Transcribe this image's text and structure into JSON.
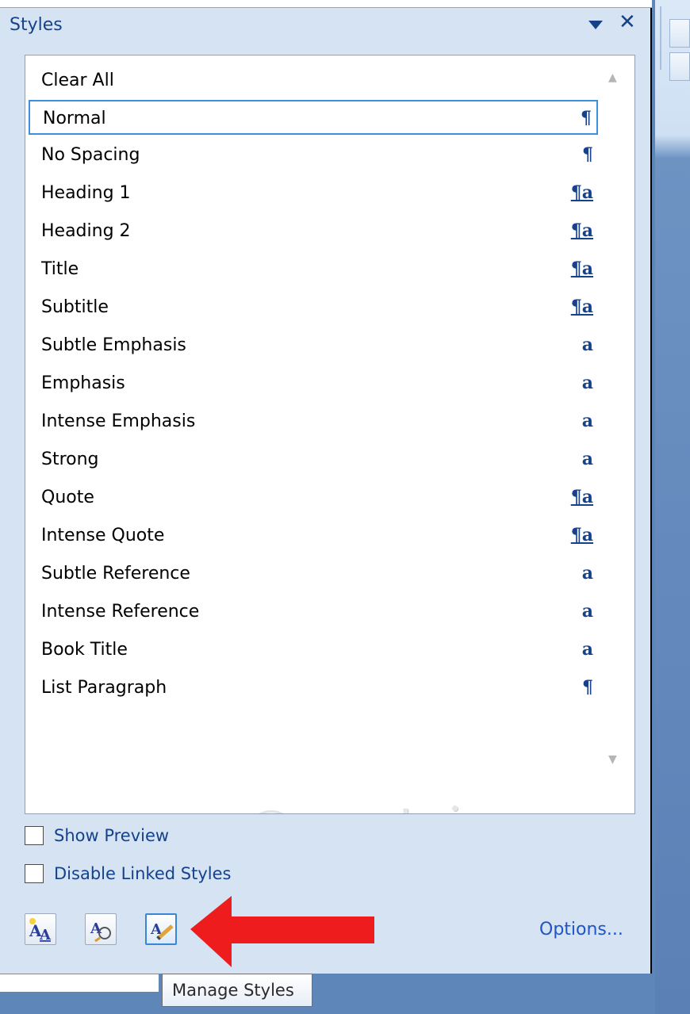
{
  "pane": {
    "title": "Styles",
    "menu_icon": "dropdown-arrow-icon",
    "close_icon": "close-icon",
    "close_glyph": "✕"
  },
  "styles_list": {
    "items": [
      {
        "label": "Clear All",
        "icon": "",
        "icon_type": "none"
      },
      {
        "label": "Normal",
        "icon": "¶",
        "icon_type": "paragraph",
        "selected": true
      },
      {
        "label": "No Spacing",
        "icon": "¶",
        "icon_type": "paragraph"
      },
      {
        "label": "Heading 1",
        "icon": "¶a",
        "icon_type": "linked"
      },
      {
        "label": "Heading 2",
        "icon": "¶a",
        "icon_type": "linked"
      },
      {
        "label": "Title",
        "icon": "¶a",
        "icon_type": "linked"
      },
      {
        "label": "Subtitle",
        "icon": "¶a",
        "icon_type": "linked"
      },
      {
        "label": "Subtle Emphasis",
        "icon": "a",
        "icon_type": "character"
      },
      {
        "label": "Emphasis",
        "icon": "a",
        "icon_type": "character"
      },
      {
        "label": "Intense Emphasis",
        "icon": "a",
        "icon_type": "character"
      },
      {
        "label": "Strong",
        "icon": "a",
        "icon_type": "character"
      },
      {
        "label": "Quote",
        "icon": "¶a",
        "icon_type": "linked"
      },
      {
        "label": "Intense Quote",
        "icon": "¶a",
        "icon_type": "linked"
      },
      {
        "label": "Subtle Reference",
        "icon": "a",
        "icon_type": "character"
      },
      {
        "label": "Intense Reference",
        "icon": "a",
        "icon_type": "character"
      },
      {
        "label": "Book Title",
        "icon": "a",
        "icon_type": "character"
      },
      {
        "label": "List Paragraph",
        "icon": "¶",
        "icon_type": "paragraph"
      }
    ]
  },
  "options": {
    "show_preview": {
      "label": "Show Preview",
      "checked": false
    },
    "disable_linked": {
      "label": "Disable Linked Styles",
      "checked": false
    }
  },
  "toolbar": {
    "new_style": {
      "icon": "new-style-icon"
    },
    "style_inspector": {
      "icon": "style-inspector-icon"
    },
    "manage_styles": {
      "icon": "manage-styles-icon"
    },
    "options_label": "Options..."
  },
  "tooltip": {
    "text": "Manage Styles"
  },
  "watermark": {
    "text": "uantrimang"
  },
  "colors": {
    "accent": "#15428b",
    "selection": "#3e8ede",
    "arrow": "#ee1c1c",
    "link": "#1f55c4"
  }
}
